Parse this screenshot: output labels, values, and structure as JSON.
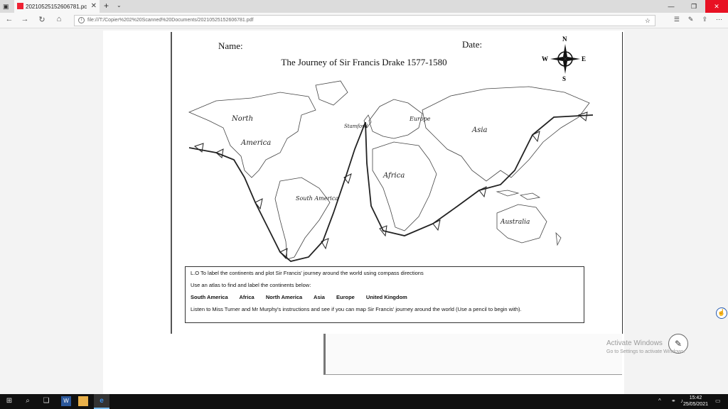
{
  "browser": {
    "tab_title": "20210525152606781.pc",
    "new_tab": "+",
    "tab_menu": "⌄",
    "url": "file:///T:/Copier%202%20Scanned%20Documents/20210525152606781.pdf"
  },
  "worksheet": {
    "name_label": "Name:",
    "date_label": "Date:",
    "title": "The Journey of Sir Francis Drake 1577-1580",
    "compass": {
      "n": "N",
      "s": "S",
      "e": "E",
      "w": "W"
    },
    "handwritten": {
      "north": "North",
      "america": "America",
      "south_america": "South America",
      "europe": "Europe",
      "asia": "Asia",
      "africa": "Africa",
      "australia": "Australia",
      "stamford": "Stamford"
    },
    "instructions": {
      "lo": "L.O To label the continents and plot Sir Francis' journey around the world using compass directions",
      "use_atlas": "Use an atlas to find and label the continents below:",
      "continents": [
        "South America",
        "Africa",
        "North America",
        "Asia",
        "Europe",
        "United Kingdom"
      ],
      "listen": "Listen to Miss Turner and Mr Murphy's instructions and see if you can map Sir Francis' journey around the world (Use a pencil to begin with)."
    }
  },
  "watermark": {
    "line1": "Activate Windows",
    "line2": "Go to Settings to activate Windows."
  },
  "taskbar": {
    "time": "15:42",
    "date": "25/05/2021"
  }
}
